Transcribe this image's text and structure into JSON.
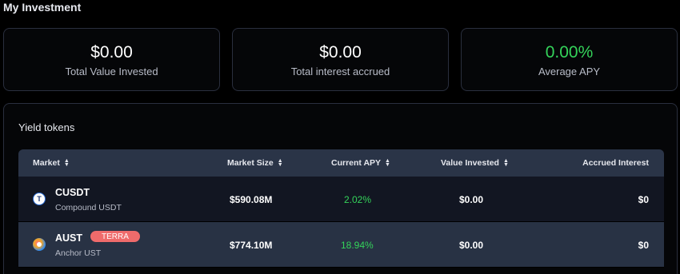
{
  "page": {
    "title": "My Investment"
  },
  "stats": [
    {
      "value": "$0.00",
      "label": "Total Value Invested"
    },
    {
      "value": "$0.00",
      "label": "Total interest accrued"
    },
    {
      "value": "0.00%",
      "label": "Average APY"
    }
  ],
  "yield": {
    "title": "Yield tokens",
    "columns": {
      "market": "Market",
      "market_size": "Market Size",
      "current_apy": "Current APY",
      "value_invested": "Value Invested",
      "accrued_interest": "Accrued Interest"
    },
    "rows": [
      {
        "symbol": "CUSDT",
        "name": "Compound USDT",
        "tag": "",
        "icon": "usdt-icon",
        "market_size": "$590.08M",
        "current_apy": "2.02%",
        "value_invested": "$0.00",
        "accrued_interest": "$0"
      },
      {
        "symbol": "AUST",
        "name": "Anchor UST",
        "tag": "TERRA",
        "icon": "aust-icon",
        "market_size": "$774.10M",
        "current_apy": "18.94%",
        "value_invested": "$0.00",
        "accrued_interest": "$0"
      }
    ]
  },
  "colors": {
    "accent_green": "#34d35a",
    "tag_red": "#ef6b6b",
    "header_bg": "#2a3447"
  }
}
